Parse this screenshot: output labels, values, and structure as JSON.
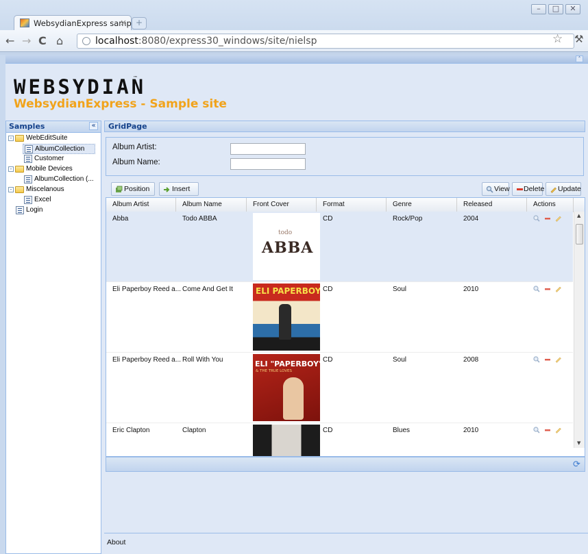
{
  "browser": {
    "tab_title": "WebsydianExpress samples",
    "tab_close": "×",
    "new_tab": "+",
    "url_host": "localhost",
    "url_path": ":8080/express30_windows/site/nielsp",
    "win_min": "–",
    "win_max": "□",
    "win_close": "✕"
  },
  "header": {
    "logo": "WEBSYDIAN",
    "logo_tm": "™",
    "site_title": "WebsydianExpress - Sample site"
  },
  "sidebar": {
    "title": "Samples",
    "items": [
      {
        "label": "WebEditSuite"
      },
      {
        "label": "AlbumCollection"
      },
      {
        "label": "Customer"
      },
      {
        "label": "Mobile Devices"
      },
      {
        "label": "AlbumCollection (..."
      },
      {
        "label": "Miscelanous"
      },
      {
        "label": "Excel"
      },
      {
        "label": "Login"
      }
    ]
  },
  "main": {
    "title": "GridPage",
    "form": {
      "artist_label": "Album Artist:",
      "name_label": "Album Name:",
      "artist_value": "",
      "name_value": ""
    },
    "buttons": {
      "position": "Position",
      "insert": "Insert",
      "view": "View",
      "delete": "Delete",
      "update": "Update"
    },
    "columns": [
      "Album Artist",
      "Album Name",
      "Front Cover",
      "Format",
      "Genre",
      "Released",
      "Actions"
    ],
    "rows": [
      {
        "artist": "Abba",
        "name": "Todo ABBA",
        "format": "CD",
        "genre": "Rock/Pop",
        "released": "2004",
        "cover_text": "ABBA",
        "cover_sub": "todo"
      },
      {
        "artist": "Eli Paperboy Reed a...",
        "name": "Come And Get It",
        "format": "CD",
        "genre": "Soul",
        "released": "2010",
        "cover_text": "ELI PAPERBOY REED"
      },
      {
        "artist": "Eli Paperboy Reed a...",
        "name": "Roll With You",
        "format": "CD",
        "genre": "Soul",
        "released": "2008",
        "cover_text": "ELI \"PAPERBOY\" REED",
        "cover_sub": "& THE TRUE LOVES"
      },
      {
        "artist": "Eric Clapton",
        "name": "Clapton",
        "format": "CD",
        "genre": "Blues",
        "released": "2010"
      }
    ],
    "about": "About"
  },
  "colors": {
    "accent": "#f1a31b",
    "panel_header": "#15428b",
    "border": "#99bbe8",
    "selected_row": "#dfe8f6"
  }
}
